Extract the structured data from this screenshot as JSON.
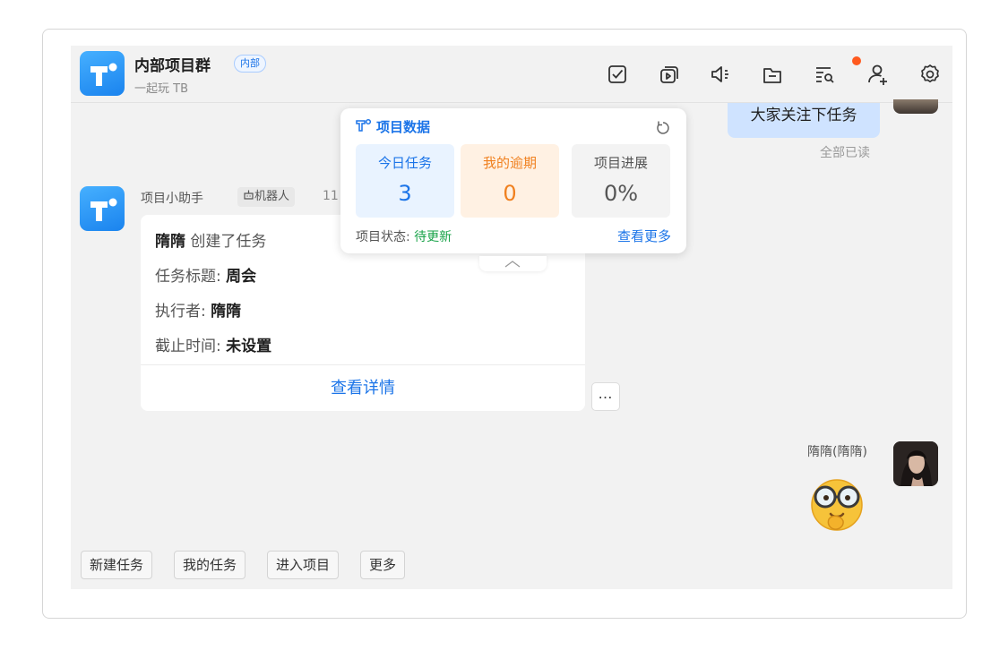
{
  "header": {
    "title": "内部项目群",
    "badge": "内部",
    "subtitle": "一起玩 TB",
    "icons": [
      "task-check-icon",
      "media-play-icon",
      "speaker-icon",
      "folder-icon",
      "search-list-icon",
      "add-member-icon",
      "settings-icon"
    ]
  },
  "messages": {
    "my_text": "大家关注下任务",
    "read_status": "全部已读",
    "bot": {
      "sender": "项目小助手",
      "tag": "机器人",
      "time": "11",
      "card": {
        "actor": "隋隋",
        "action": "创建了任务",
        "title_label": "任务标题:",
        "title_value": "周会",
        "assignee_label": "执行者:",
        "assignee_value": "隋隋",
        "due_label": "截止时间:",
        "due_value": "未设置",
        "link": "查看详情"
      },
      "more": "…"
    },
    "user_name": "隋隋(隋隋)"
  },
  "popup": {
    "title": "项目数据",
    "stats": [
      {
        "label": "今日任务",
        "value": "3"
      },
      {
        "label": "我的逾期",
        "value": "0"
      },
      {
        "label": "项目进展",
        "value": "0%"
      }
    ],
    "status_label": "项目状态:",
    "status_value": "待更新",
    "more": "查看更多"
  },
  "quick_actions": [
    "新建任务",
    "我的任务",
    "进入项目",
    "更多"
  ],
  "colors": {
    "accent": "#1b74e8",
    "overdue": "#f0801f",
    "status_green": "#1aa34a",
    "notification": "#ff5a1f"
  }
}
